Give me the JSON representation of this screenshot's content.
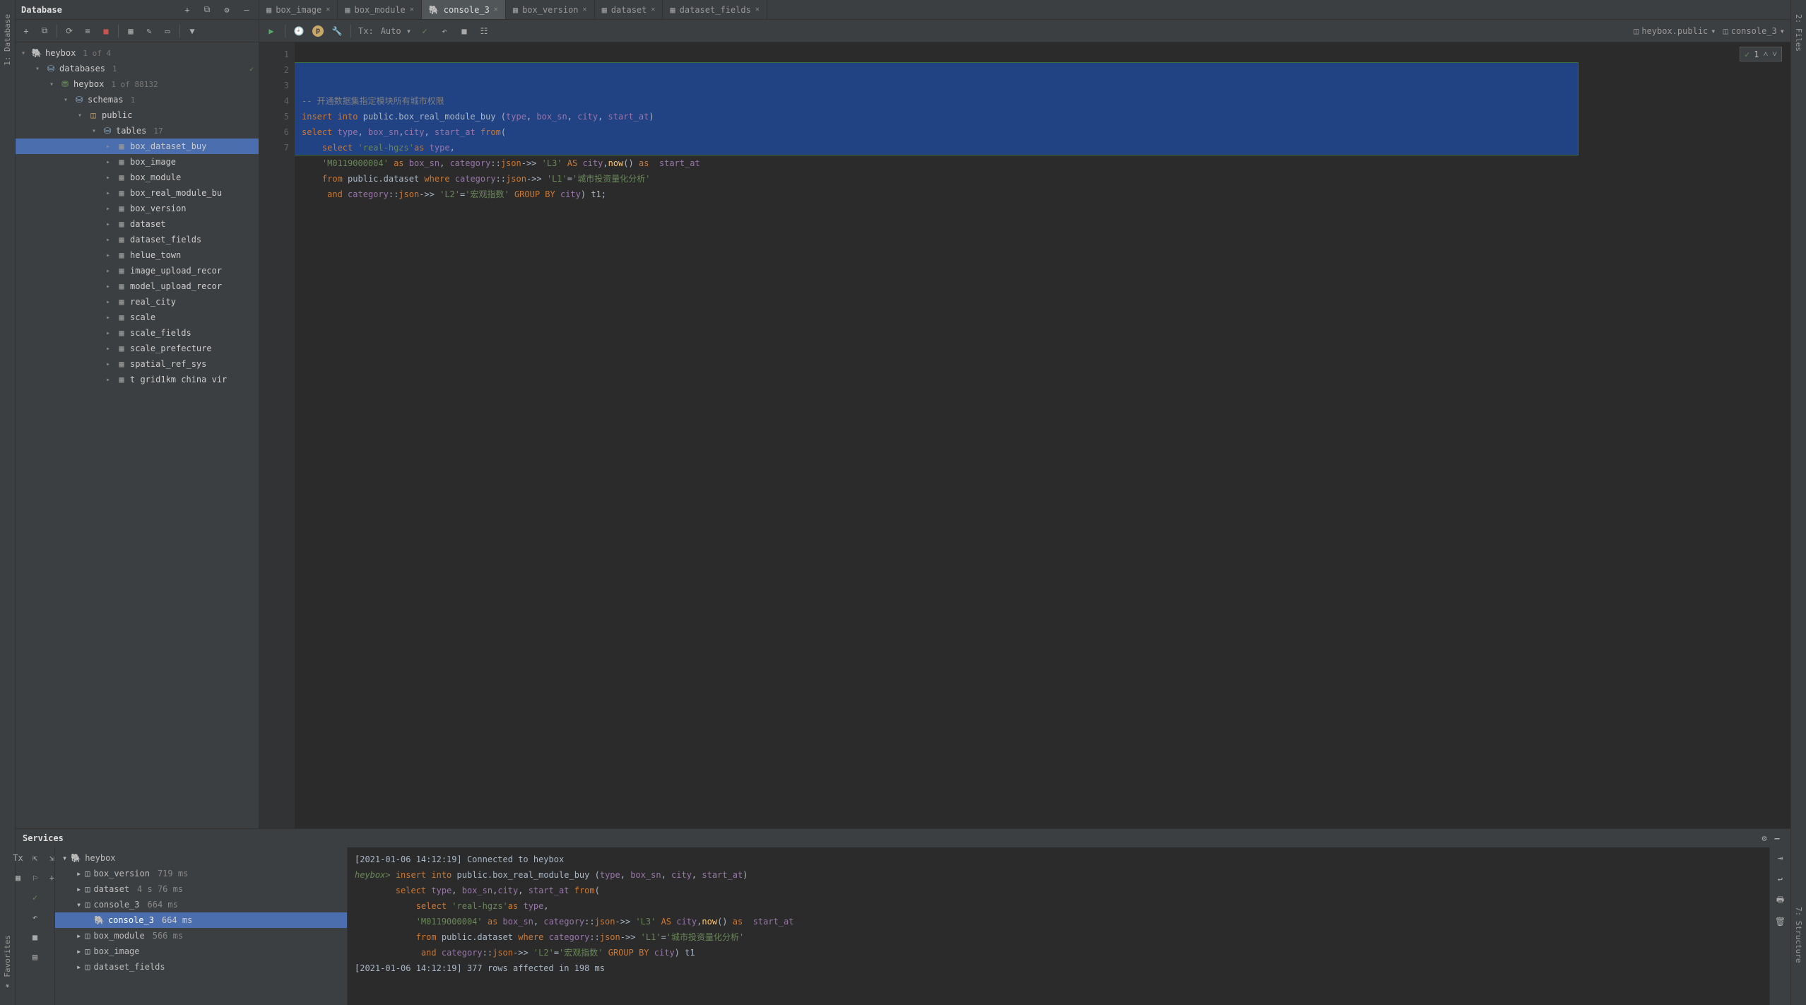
{
  "left_gutter": {
    "database": "1: Database",
    "favorites": "Favorites"
  },
  "right_gutter": {
    "files": "2: Files",
    "structure": "7: Structure"
  },
  "db_panel": {
    "title": "Database",
    "root": {
      "name": "heybox",
      "hint": "1 of 4"
    },
    "databases": {
      "label": "databases",
      "hint": "1"
    },
    "heybox_db": {
      "label": "heybox",
      "hint": "1 of 88132"
    },
    "schemas": {
      "label": "schemas",
      "hint": "1"
    },
    "public": {
      "label": "public"
    },
    "tables": {
      "label": "tables",
      "hint": "17"
    },
    "table_list": [
      "box_dataset_buy",
      "box_image",
      "box_module",
      "box_real_module_bu",
      "box_version",
      "dataset",
      "dataset_fields",
      "helue_town",
      "image_upload_recor",
      "model_upload_recor",
      "real_city",
      "scale",
      "scale_fields",
      "scale_prefecture",
      "spatial_ref_sys",
      "t grid1km china vir"
    ]
  },
  "tabs": [
    {
      "icon": "table",
      "label": "box_image"
    },
    {
      "icon": "table",
      "label": "box_module"
    },
    {
      "icon": "console",
      "label": "console_3",
      "active": true
    },
    {
      "icon": "table",
      "label": "box_version"
    },
    {
      "icon": "table",
      "label": "dataset"
    },
    {
      "icon": "table",
      "label": "dataset_fields"
    }
  ],
  "editor_toolbar": {
    "tx": "Tx:",
    "auto": "Auto",
    "schema": "heybox.public",
    "console": "console_3"
  },
  "inspection": {
    "count": "1"
  },
  "code_lines": [
    {
      "n": "1",
      "html": "<span class='cmt'>-- 开通数据集指定模块所有城市权限</span>"
    },
    {
      "n": "2",
      "check": true,
      "html": "<span class='kw'>insert into</span> <span class='plain'>public.box_real_module_buy (</span><span class='id'>type</span><span class='plain'>, </span><span class='id'>box_sn</span><span class='plain'>, </span><span class='id'>city</span><span class='plain'>, </span><span class='id'>start_at</span><span class='plain'>)</span>"
    },
    {
      "n": "3",
      "html": "<span class='kw'>select</span> <span class='id'>type</span><span class='plain'>, </span><span class='id'>box_sn</span><span class='plain'>,</span><span class='id'>city</span><span class='plain'>, </span><span class='id'>start_at</span> <span class='kw'>from</span><span class='plain'>(</span>"
    },
    {
      "n": "4",
      "html": "    <span class='kw'>select</span> <span class='str'>'real-hgzs'</span><span class='kw'>as</span> <span class='id'>type</span><span class='plain'>,</span>"
    },
    {
      "n": "5",
      "html": "    <span class='str'>'M0119000004'</span> <span class='kw'>as</span> <span class='id'>box_sn</span><span class='plain'>, </span><span class='id'>category</span><span class='plain'>::</span><span class='kw'>json</span><span class='plain'>->> </span><span class='str'>'L3'</span> <span class='kw'>AS</span> <span class='id'>city</span><span class='plain'>,</span><span class='fn'>now</span><span class='plain'>() </span><span class='kw'>as</span>  <span class='id'>start_at</span>"
    },
    {
      "n": "6",
      "html": "    <span class='kw'>from</span> <span class='plain'>public.dataset </span><span class='kw'>where</span> <span class='id'>category</span><span class='plain'>::</span><span class='kw'>json</span><span class='plain'>->> </span><span class='str'>'L1'</span><span class='plain'>=</span><span class='str'>'城市投资量化分析'</span>"
    },
    {
      "n": "7",
      "html": "     <span class='kw'>and</span> <span class='id'>category</span><span class='plain'>::</span><span class='kw'>json</span><span class='plain'>->> </span><span class='str'>'L2'</span><span class='plain'>=</span><span class='str'>'宏观指数'</span> <span class='kw'>GROUP BY</span> <span class='id'>city</span><span class='plain'>) t1;</span>"
    }
  ],
  "services": {
    "title": "Services",
    "tree": [
      {
        "indent": 0,
        "chev": "▾",
        "icon": "db",
        "label": "heybox",
        "hint": ""
      },
      {
        "indent": 1,
        "chev": "▸",
        "icon": "q",
        "label": "box_version",
        "hint": "719 ms"
      },
      {
        "indent": 1,
        "chev": "▸",
        "icon": "q",
        "label": "dataset",
        "hint": "4 s 76 ms"
      },
      {
        "indent": 1,
        "chev": "▾",
        "icon": "q",
        "label": "console_3",
        "hint": "664 ms"
      },
      {
        "indent": 2,
        "chev": "",
        "icon": "pg",
        "label": "console_3",
        "hint": "664 ms",
        "selected": true
      },
      {
        "indent": 1,
        "chev": "▸",
        "icon": "q",
        "label": "box_module",
        "hint": "566 ms"
      },
      {
        "indent": 1,
        "chev": "▸",
        "icon": "q",
        "label": "box_image",
        "hint": ""
      },
      {
        "indent": 1,
        "chev": "▸",
        "icon": "q",
        "label": "dataset_fields",
        "hint": ""
      }
    ]
  },
  "console_output": [
    "<span class='plain'>[2021-01-06 14:12:19] Connected to heybox</span>",
    "<span class='prompt'>heybox></span> <span class='kw'>insert into</span> <span class='plain'>public</span><span class='plain'>.box_real_module_buy (</span><span class='id'>type</span><span class='plain'>, </span><span class='id'>box_sn</span><span class='plain'>, </span><span class='id'>city</span><span class='plain'>, </span><span class='id'>start_at</span><span class='plain'>)</span>",
    "        <span class='kw'>select</span> <span class='id'>type</span><span class='plain'>, </span><span class='id'>box_sn</span><span class='plain'>,</span><span class='id'>city</span><span class='plain'>, </span><span class='id'>start_at</span> <span class='kw'>from</span><span class='plain'>(</span>",
    "            <span class='kw'>select</span> <span class='str'>'real-hgzs'</span><span class='kw'>as</span> <span class='id'>type</span><span class='plain'>,</span>",
    "            <span class='str'>'M0119000004'</span> <span class='kw'>as</span> <span class='id'>box_sn</span><span class='plain'>, </span><span class='id'>category</span><span class='plain'>::</span><span class='kw'>json</span><span class='plain'>->> </span><span class='str'>'L3'</span> <span class='kw'>AS</span> <span class='id'>city</span><span class='plain'>,</span><span class='fn'>now</span><span class='plain'>() </span><span class='kw'>as</span>  <span class='id'>start_at</span>",
    "            <span class='kw'>from</span> <span class='plain'>public</span><span class='plain'>.dataset </span><span class='kw'>where</span> <span class='id'>category</span><span class='plain'>::</span><span class='kw'>json</span><span class='plain'>->> </span><span class='str'>'L1'</span><span class='plain'>=</span><span class='str'>'城市投资量化分析'</span>",
    "             <span class='kw'>and</span> <span class='id'>category</span><span class='plain'>::</span><span class='kw'>json</span><span class='plain'>->> </span><span class='str'>'L2'</span><span class='plain'>=</span><span class='str'>'宏观指数'</span> <span class='kw'>GROUP BY</span> <span class='id'>city</span><span class='plain'>) t1</span>",
    "<span class='plain'>[2021-01-06 14:12:19] 377 rows affected in 198 ms</span>"
  ]
}
